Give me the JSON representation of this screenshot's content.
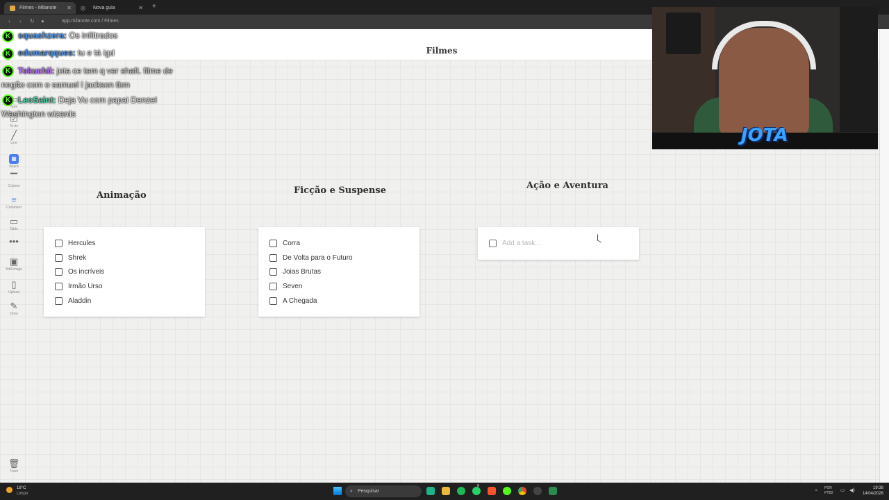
{
  "browser": {
    "tabs": [
      {
        "label": "Filmes - Milanote",
        "active": true
      },
      {
        "label": "Nova guia",
        "active": false
      }
    ],
    "url": "app.milanote.com / Filmes"
  },
  "board": {
    "title": "Filmes"
  },
  "toolbar": {
    "items": [
      {
        "icon": "note-icon",
        "label": "Note"
      },
      {
        "icon": "todo-icon",
        "label": "To-do"
      },
      {
        "icon": "line-icon",
        "label": "Line"
      },
      {
        "icon": "board-icon",
        "label": "Board"
      },
      {
        "icon": "column-icon",
        "label": "Column"
      },
      {
        "icon": "comment-icon",
        "label": "Comment"
      },
      {
        "icon": "table-icon",
        "label": "Table"
      },
      {
        "icon": "more-icon",
        "label": ""
      },
      {
        "icon": "image-icon",
        "label": "Add image"
      },
      {
        "icon": "upload-icon",
        "label": "Upload"
      },
      {
        "icon": "draw-icon",
        "label": "Draw"
      },
      {
        "icon": "trash-icon",
        "label": "Trash"
      }
    ]
  },
  "columns": [
    {
      "title": "Animação",
      "tasks": [
        "Hercules",
        "Shrek",
        "Os incríveis",
        "Irmão Urso",
        "Aladdin"
      ]
    },
    {
      "title": "Ficção e Suspense",
      "tasks": [
        "Corra",
        "De Volta para o Futuro",
        "Joias Brutas",
        "Seven",
        "A Chegada"
      ]
    },
    {
      "title": "Ação e Aventura",
      "tasks": [],
      "placeholder": "Add a task..."
    }
  ],
  "chat": [
    {
      "nick": "squashzera:",
      "color": "#4a90e2",
      "text": "Os infiltrados",
      "cont": ""
    },
    {
      "nick": "edumarqques:",
      "color": "#4a90e2",
      "text": "tu e tá igd",
      "cont": ""
    },
    {
      "nick": "Tokuchii:",
      "color": "#b36cf0",
      "text": "jota ce tem q ver shaft. filme de",
      "cont": "negão com o samuel l jackson tbm"
    },
    {
      "nick": "LeoSaint:",
      "color": "#4fd1a5",
      "text": "Deja Vu com papai Denzel",
      "cont": "Washington wizards"
    }
  ],
  "webcam": {
    "logo": "JOTA"
  },
  "taskbar": {
    "weather_temp": "18°C",
    "weather_desc": "Limpo",
    "search": "Pesquisar",
    "lang1": "POR",
    "lang2": "PTB2",
    "time": "19:38",
    "date": "14/04/2026",
    "whatsapp_badge": "9"
  }
}
